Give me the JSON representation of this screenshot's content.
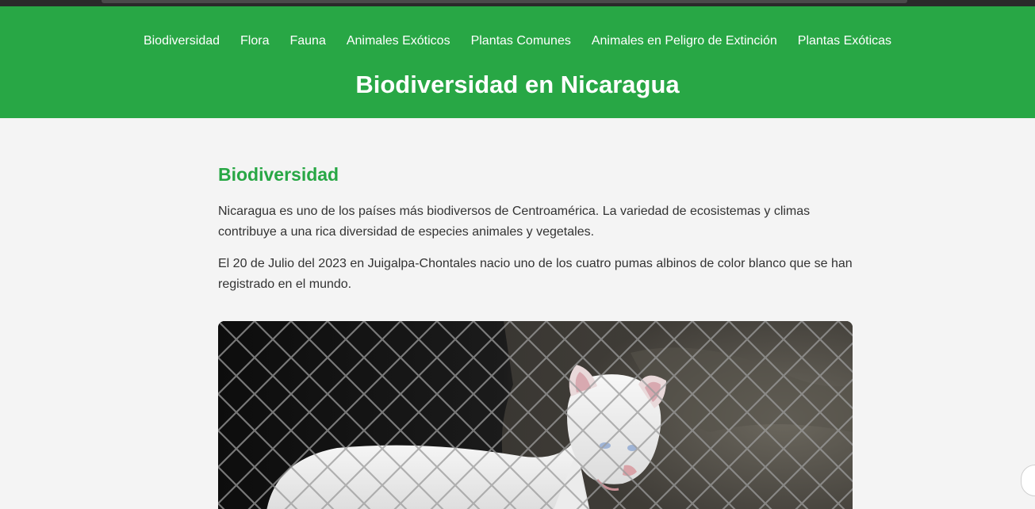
{
  "nav": {
    "items": [
      "Biodiversidad",
      "Flora",
      "Fauna",
      "Animales Exóticos",
      "Plantas Comunes",
      "Animales en Peligro de Extinción",
      "Plantas Exóticas"
    ]
  },
  "header": {
    "title": "Biodiversidad en Nicaragua"
  },
  "section": {
    "heading": "Biodiversidad",
    "paragraphs": [
      "Nicaragua es uno de los países más biodiversos de Centroamérica. La variedad de ecosistemas y climas contribuye a una rica diversidad de especies animales y vegetales.",
      "El 20 de Julio del 2023 en Juigalpa-Chontales nacio uno de los cuatro pumas albinos de color blanco que se han registrado en el mundo."
    ]
  },
  "colors": {
    "brand_green": "#28a745",
    "page_background": "#f4f4f4",
    "body_text": "#333333"
  }
}
